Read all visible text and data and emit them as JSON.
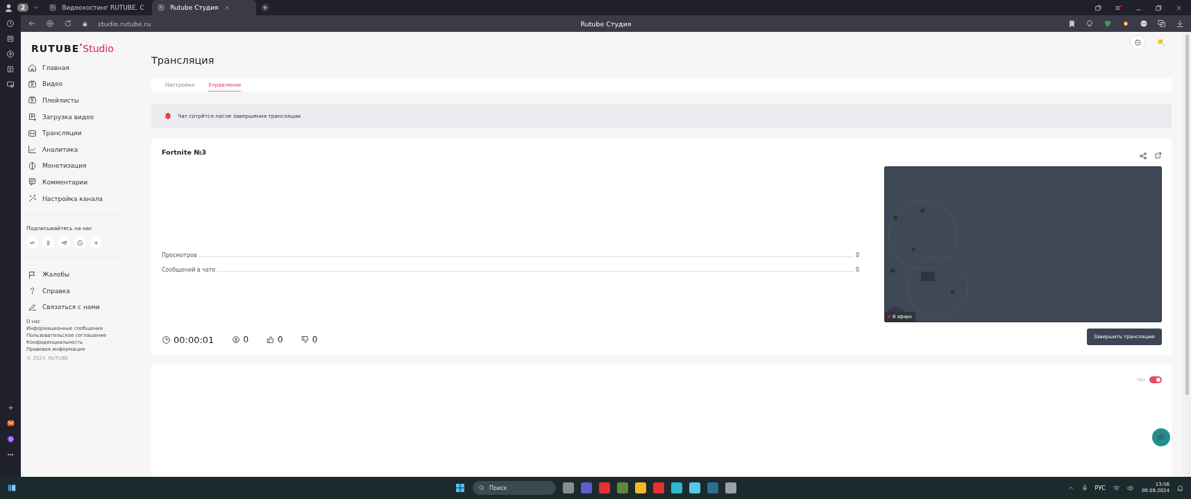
{
  "browser": {
    "tab_count": "2",
    "tabs": [
      {
        "title": "Видеохостинг RUTUBE. С",
        "selected": false
      },
      {
        "title": "Rutube Студия",
        "selected": true
      }
    ],
    "address": "studio.rutube.ru",
    "page_title": "Rutube Студия"
  },
  "logo": {
    "brand": "RUTUBE",
    "product": "Studio"
  },
  "sidebar": {
    "items": [
      {
        "label": "Главная"
      },
      {
        "label": "Видео"
      },
      {
        "label": "Плейлисты"
      },
      {
        "label": "Загрузка видео"
      },
      {
        "label": "Трансляции"
      },
      {
        "label": "Аналитика"
      },
      {
        "label": "Монетизация"
      },
      {
        "label": "Комментарии"
      },
      {
        "label": "Настройка канала"
      }
    ],
    "subscribe_title": "Подписывайтесь на нас",
    "support_items": [
      {
        "label": "Жалобы"
      },
      {
        "label": "Справка"
      },
      {
        "label": "Связаться с нами"
      }
    ],
    "footer_links": [
      "О нас",
      "Информационные сообщения",
      "Пользовательское соглашение",
      "Конфиденциальность",
      "Правовая информация"
    ],
    "copyright": "© 2024, RUTUBE"
  },
  "page": {
    "title": "Трансляция",
    "tabs": [
      {
        "label": "Настройки",
        "selected": false
      },
      {
        "label": "Управление",
        "selected": true
      }
    ],
    "notice": "Чат сотрётся после завершения трансляции",
    "stream": {
      "title": "Fortnite №3",
      "stats": [
        {
          "label": "Просмотров",
          "value": "0"
        },
        {
          "label": "Сообщений в чате",
          "value": "0"
        }
      ],
      "duration": "00:00:01",
      "viewers": "0",
      "likes": "0",
      "dislikes": "0",
      "preview": {
        "kind": "picture",
        "badge": "В эфире"
      },
      "end_button": "Завершить трансляцию"
    },
    "chat": {
      "label": "Чат",
      "on": true
    }
  },
  "taskbar": {
    "search": "Поиск",
    "language": "РУС",
    "time": "13:56",
    "date": "09.09.2024"
  }
}
